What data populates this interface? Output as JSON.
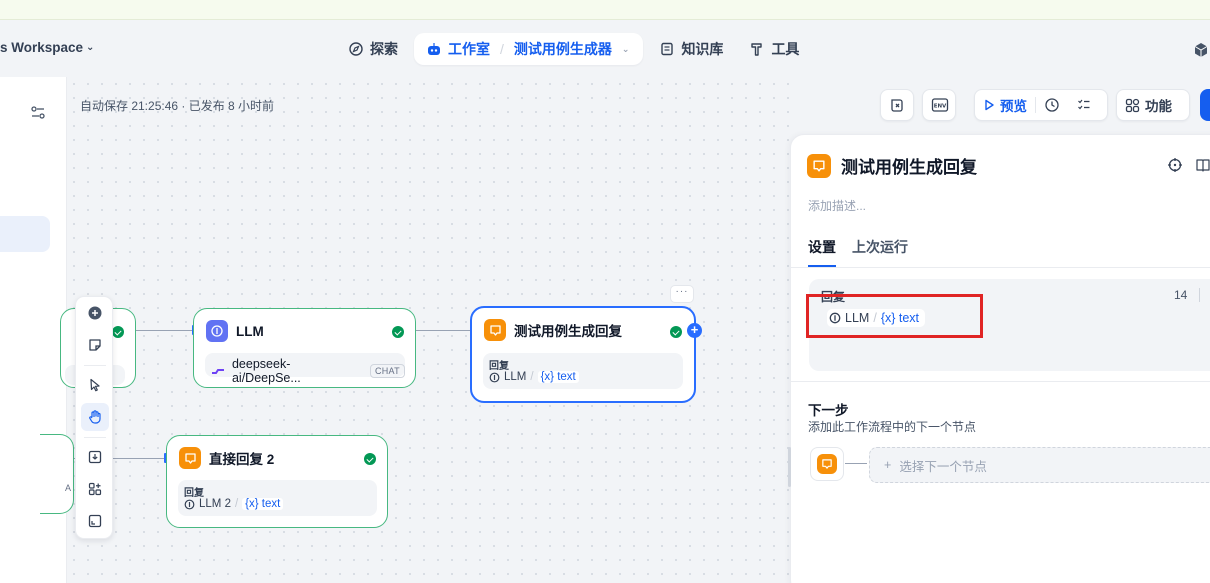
{
  "workspace": {
    "name": "s Workspace"
  },
  "nav": {
    "explore": "探索",
    "studio": "工作室",
    "app_name": "测试用例生成器",
    "knowledge": "知识库",
    "tools": "工具"
  },
  "status": {
    "autosave": "自动保存 21:25:46 · 已发布 8 小时前"
  },
  "toolbar": {
    "env_label": "ENV",
    "preview": "预览",
    "features": "功能"
  },
  "nodes": {
    "llm": {
      "title": "LLM",
      "model": "deepseek-ai/DeepSe...",
      "badge": "CHAT"
    },
    "reply": {
      "title": "测试用例生成回复",
      "field_label": "回复",
      "var_source": "LLM",
      "var_name": "{x} text"
    },
    "reply2": {
      "title": "直接回复 2",
      "field_label": "回复",
      "var_source": "LLM 2",
      "var_name": "{x} text"
    },
    "partial_badge": "A"
  },
  "panel": {
    "title": "测试用例生成回复",
    "desc_placeholder": "添加描述...",
    "tabs": [
      "设置",
      "上次运行"
    ],
    "reply_label": "回复",
    "reply_count": "14",
    "var_source": "LLM",
    "var_name": "{x} text",
    "next_title": "下一步",
    "next_desc": "添加此工作流程中的下一个节点",
    "next_select": "选择下一个节点"
  },
  "colors": {
    "accent": "#155eef",
    "success": "#039855",
    "node_orange": "#f79009",
    "node_purple": "#6172f3",
    "highlight": "#e02424"
  }
}
